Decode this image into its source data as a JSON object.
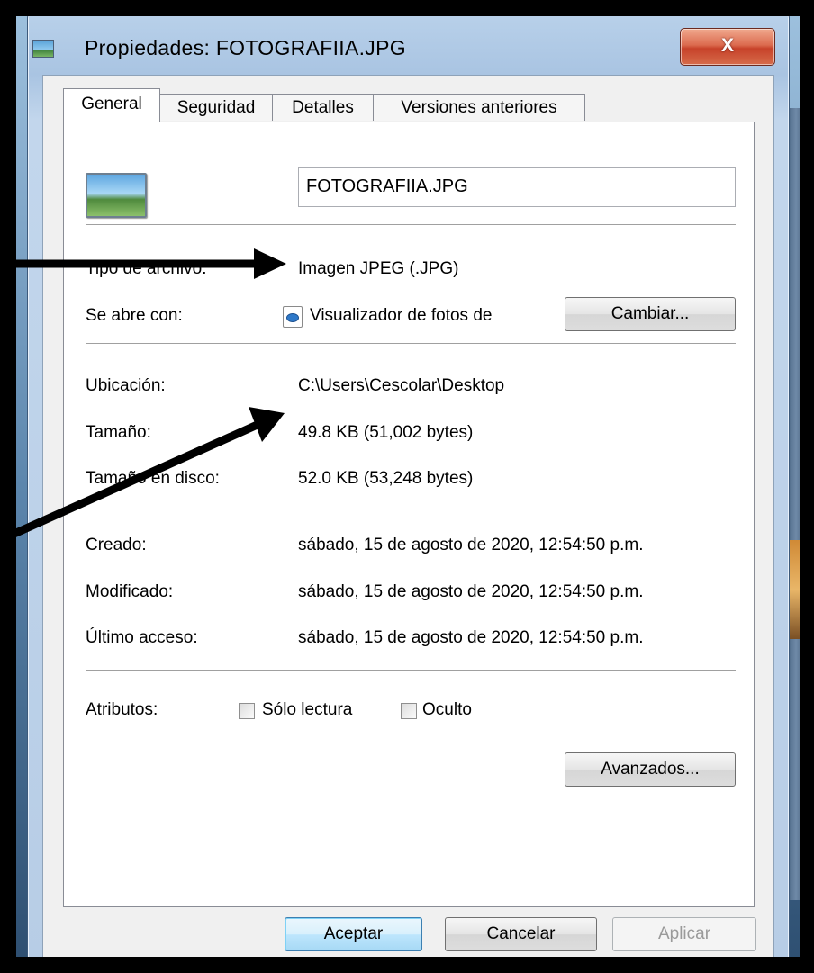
{
  "window": {
    "title": "Propiedades: FOTOGRAFIIA.JPG",
    "close_label": "X"
  },
  "tabs": [
    {
      "label": "General",
      "active": true
    },
    {
      "label": "Seguridad",
      "active": false
    },
    {
      "label": "Detalles",
      "active": false
    },
    {
      "label": "Versiones anteriores",
      "active": false
    }
  ],
  "general": {
    "file_name": "FOTOGRAFIIA.JPG",
    "file_type_label": "Tipo de archivo:",
    "file_type_value": "Imagen JPEG (.JPG)",
    "opens_with_label": "Se abre con:",
    "opens_with_value": "Visualizador de fotos de",
    "change_button": "Cambiar...",
    "location_label": "Ubicación:",
    "location_value": "C:\\Users\\Cescolar\\Desktop",
    "size_label": "Tamaño:",
    "size_value": "49.8 KB (51,002 bytes)",
    "size_on_disk_label": "Tamaño en disco:",
    "size_on_disk_value": "52.0 KB (53,248 bytes)",
    "created_label": "Creado:",
    "created_value": "sábado, 15 de agosto de 2020, 12:54:50 p.m.",
    "modified_label": "Modificado:",
    "modified_value": "sábado, 15 de agosto de 2020, 12:54:50 p.m.",
    "accessed_label": "Último acceso:",
    "accessed_value": "sábado, 15 de agosto de 2020, 12:54:50 p.m.",
    "attributes_label": "Atributos:",
    "readonly_label": "Sólo lectura",
    "readonly_checked": false,
    "hidden_label": "Oculto",
    "hidden_checked": false,
    "advanced_button": "Avanzados..."
  },
  "footer": {
    "ok": "Aceptar",
    "cancel": "Cancelar",
    "apply": "Aplicar"
  },
  "icons": {
    "window_icon": "image-file-icon",
    "file_icon": "jpeg-thumbnail-icon",
    "app_icon": "photo-viewer-icon"
  }
}
